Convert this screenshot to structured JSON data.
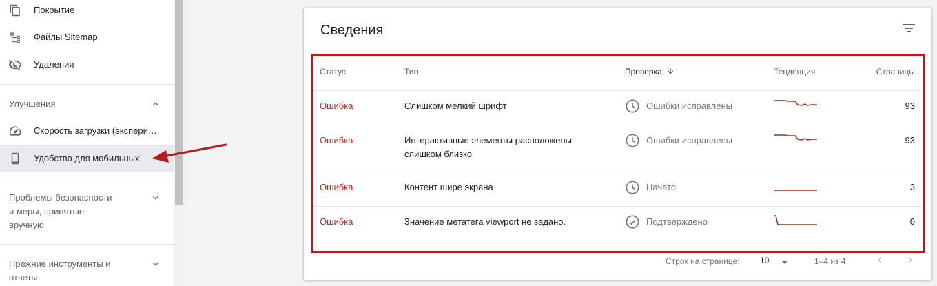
{
  "sidebar": {
    "items": [
      {
        "label": "Покрытие",
        "icon": "pages-copy-icon"
      },
      {
        "label": "Файлы Sitemap",
        "icon": "sitemap-icon"
      },
      {
        "label": "Удаления",
        "icon": "eye-off-icon"
      }
    ],
    "enhancements": {
      "title": "Улучшения",
      "items": [
        {
          "label": "Скорость загрузки (экспериментальный отчет)",
          "icon": "speed-gauge-icon"
        },
        {
          "label": "Удобство для мобильных",
          "icon": "smartphone-icon",
          "active": true
        }
      ]
    },
    "security": {
      "title_line1": "Проблемы безопасности",
      "title_line2": "и меры, принятые",
      "title_line3": "вручную"
    },
    "legacy": {
      "title_line1": "Прежние инструменты и",
      "title_line2": "отчеты"
    }
  },
  "card": {
    "title": "Сведения",
    "columns": {
      "status": "Статус",
      "type": "Тип",
      "validation": "Проверка",
      "trend": "Тенденция",
      "pages": "Страницы"
    },
    "rows": [
      {
        "status": "Ошибка",
        "type_line1": "Слишком мелкий шрифт",
        "type_line2": "",
        "validation": "Ошибки исправлены",
        "validation_icon": "clock-icon",
        "pages": "93"
      },
      {
        "status": "Ошибка",
        "type_line1": "Интерактивные элементы расположены",
        "type_line2": "слишком близко",
        "validation": "Ошибки исправлены",
        "validation_icon": "clock-icon",
        "pages": "93"
      },
      {
        "status": "Ошибка",
        "type_line1": "Контент шире экрана",
        "type_line2": "",
        "validation": "Начато",
        "validation_icon": "clock-icon",
        "pages": "3"
      },
      {
        "status": "Ошибка",
        "type_line1": "Значение метатега viewport не задано.",
        "type_line2": "",
        "validation": "Подтверждено",
        "validation_icon": "check-circle-icon",
        "pages": "0"
      }
    ],
    "pagination": {
      "rows_per_page_label": "Строк на странице:",
      "rows_per_page": "10",
      "range": "1–4 из 4"
    }
  },
  "colors": {
    "error": "#c5221f",
    "annotation": "#b71c1c",
    "trend_line": "#b3261e"
  }
}
